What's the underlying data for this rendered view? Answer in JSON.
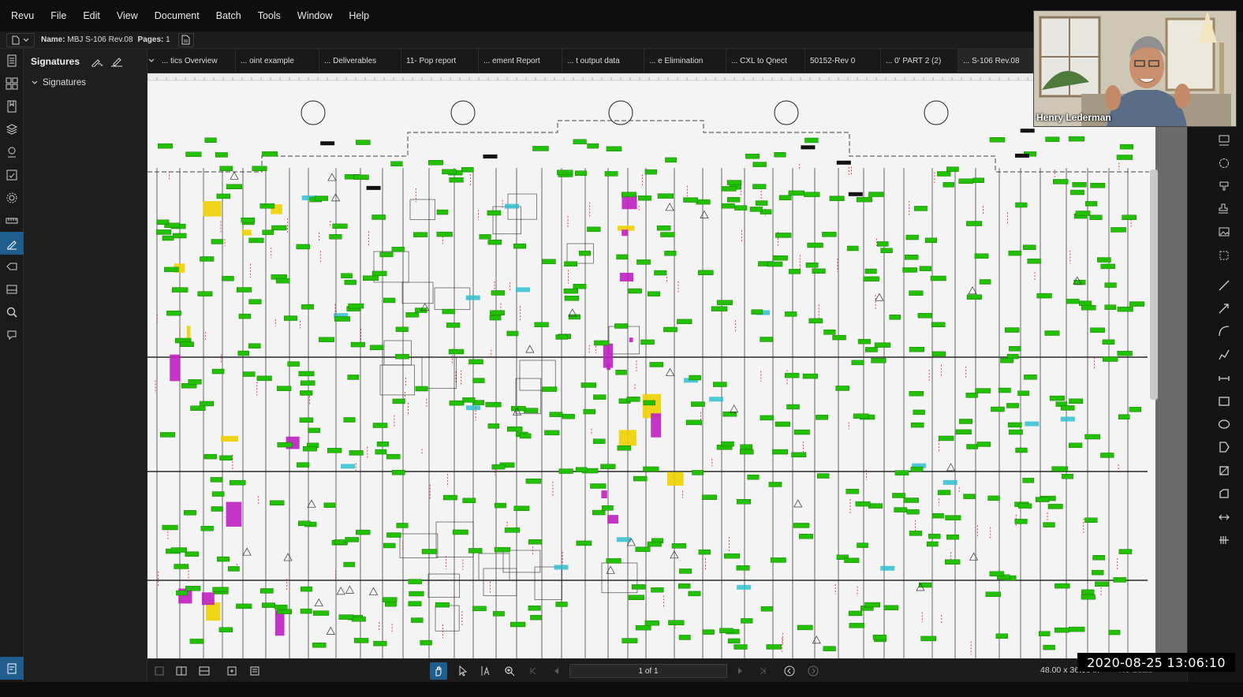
{
  "menu": [
    "Revu",
    "File",
    "Edit",
    "View",
    "Document",
    "Batch",
    "Tools",
    "Window",
    "Help"
  ],
  "document": {
    "name_label": "Name:",
    "name_value": "MBJ S-106 Rev.08",
    "pages_label": "Pages:",
    "pages_value": "1"
  },
  "panel": {
    "title": "Signatures",
    "tree_item": "Signatures"
  },
  "tabs": [
    "... tics Overview",
    "... oint example",
    "... Deliverables",
    "11- Pop report",
    "... ement Report",
    "... t output data",
    "... e Elimination",
    "... CXL to Qnect",
    "50152-Rev 0",
    "... 0' PART 2 (2)",
    "... S-106 Rev.08"
  ],
  "navigation": {
    "page_indicator": "1 of 1",
    "page_size": "48.00 x 36.00 in",
    "scale": "No Scale"
  },
  "video": {
    "participant_name": "Henry Lederman"
  },
  "timestamp": "2020-08-25  13:06:10",
  "colors": {
    "active_blue": "#1f5d8c",
    "markup_green": "#22c000",
    "markup_magenta": "#c020c0",
    "markup_yellow": "#f0d000",
    "markup_red": "#e01818",
    "markup_cyan": "#30c0d0"
  },
  "icons": {
    "left_rail": [
      "file-icon",
      "thumbnails-icon",
      "bookmarks-icon",
      "layers-icon",
      "places-icon",
      "markups-list-icon",
      "settings-icon",
      "measure-icon",
      "signatures-icon",
      "links-icon",
      "stamp-icon",
      "search-icon",
      "studio-icon"
    ],
    "right_rail": [
      "callout-icon",
      "cloud-icon",
      "highlight-icon",
      "stamp-icon",
      "image-icon",
      "snapshot-icon",
      "line-icon",
      "arrow-icon",
      "arc-icon",
      "polyline-icon",
      "dimension-icon",
      "rectangle-icon",
      "ellipse-icon",
      "polygon-icon",
      "area-icon",
      "perimeter-icon",
      "length-icon",
      "count-icon"
    ]
  }
}
